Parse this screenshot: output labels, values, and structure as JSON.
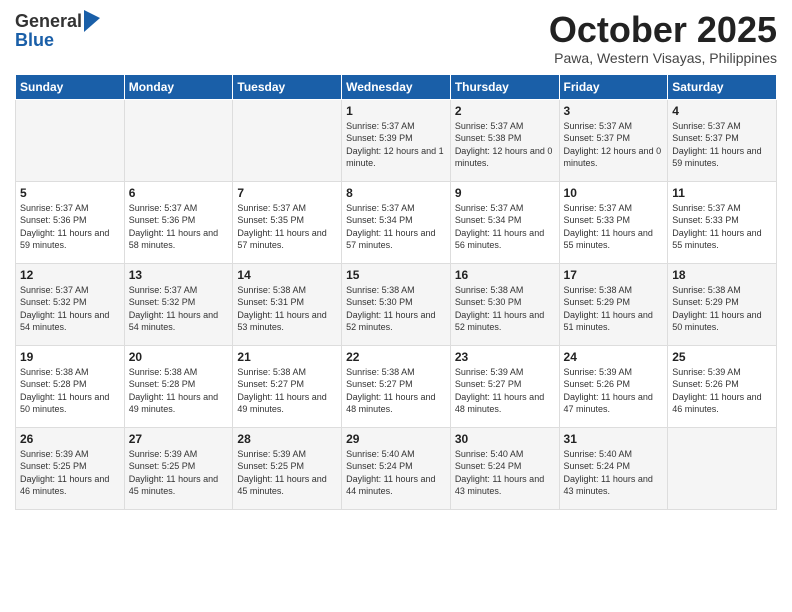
{
  "header": {
    "logo_line1": "General",
    "logo_line2": "Blue",
    "month_title": "October 2025",
    "location": "Pawa, Western Visayas, Philippines"
  },
  "days_of_week": [
    "Sunday",
    "Monday",
    "Tuesday",
    "Wednesday",
    "Thursday",
    "Friday",
    "Saturday"
  ],
  "weeks": [
    [
      {
        "day": "",
        "text": ""
      },
      {
        "day": "",
        "text": ""
      },
      {
        "day": "",
        "text": ""
      },
      {
        "day": "1",
        "text": "Sunrise: 5:37 AM\nSunset: 5:39 PM\nDaylight: 12 hours and 1 minute."
      },
      {
        "day": "2",
        "text": "Sunrise: 5:37 AM\nSunset: 5:38 PM\nDaylight: 12 hours and 0 minutes."
      },
      {
        "day": "3",
        "text": "Sunrise: 5:37 AM\nSunset: 5:37 PM\nDaylight: 12 hours and 0 minutes."
      },
      {
        "day": "4",
        "text": "Sunrise: 5:37 AM\nSunset: 5:37 PM\nDaylight: 11 hours and 59 minutes."
      }
    ],
    [
      {
        "day": "5",
        "text": "Sunrise: 5:37 AM\nSunset: 5:36 PM\nDaylight: 11 hours and 59 minutes."
      },
      {
        "day": "6",
        "text": "Sunrise: 5:37 AM\nSunset: 5:36 PM\nDaylight: 11 hours and 58 minutes."
      },
      {
        "day": "7",
        "text": "Sunrise: 5:37 AM\nSunset: 5:35 PM\nDaylight: 11 hours and 57 minutes."
      },
      {
        "day": "8",
        "text": "Sunrise: 5:37 AM\nSunset: 5:34 PM\nDaylight: 11 hours and 57 minutes."
      },
      {
        "day": "9",
        "text": "Sunrise: 5:37 AM\nSunset: 5:34 PM\nDaylight: 11 hours and 56 minutes."
      },
      {
        "day": "10",
        "text": "Sunrise: 5:37 AM\nSunset: 5:33 PM\nDaylight: 11 hours and 55 minutes."
      },
      {
        "day": "11",
        "text": "Sunrise: 5:37 AM\nSunset: 5:33 PM\nDaylight: 11 hours and 55 minutes."
      }
    ],
    [
      {
        "day": "12",
        "text": "Sunrise: 5:37 AM\nSunset: 5:32 PM\nDaylight: 11 hours and 54 minutes."
      },
      {
        "day": "13",
        "text": "Sunrise: 5:37 AM\nSunset: 5:32 PM\nDaylight: 11 hours and 54 minutes."
      },
      {
        "day": "14",
        "text": "Sunrise: 5:38 AM\nSunset: 5:31 PM\nDaylight: 11 hours and 53 minutes."
      },
      {
        "day": "15",
        "text": "Sunrise: 5:38 AM\nSunset: 5:30 PM\nDaylight: 11 hours and 52 minutes."
      },
      {
        "day": "16",
        "text": "Sunrise: 5:38 AM\nSunset: 5:30 PM\nDaylight: 11 hours and 52 minutes."
      },
      {
        "day": "17",
        "text": "Sunrise: 5:38 AM\nSunset: 5:29 PM\nDaylight: 11 hours and 51 minutes."
      },
      {
        "day": "18",
        "text": "Sunrise: 5:38 AM\nSunset: 5:29 PM\nDaylight: 11 hours and 50 minutes."
      }
    ],
    [
      {
        "day": "19",
        "text": "Sunrise: 5:38 AM\nSunset: 5:28 PM\nDaylight: 11 hours and 50 minutes."
      },
      {
        "day": "20",
        "text": "Sunrise: 5:38 AM\nSunset: 5:28 PM\nDaylight: 11 hours and 49 minutes."
      },
      {
        "day": "21",
        "text": "Sunrise: 5:38 AM\nSunset: 5:27 PM\nDaylight: 11 hours and 49 minutes."
      },
      {
        "day": "22",
        "text": "Sunrise: 5:38 AM\nSunset: 5:27 PM\nDaylight: 11 hours and 48 minutes."
      },
      {
        "day": "23",
        "text": "Sunrise: 5:39 AM\nSunset: 5:27 PM\nDaylight: 11 hours and 48 minutes."
      },
      {
        "day": "24",
        "text": "Sunrise: 5:39 AM\nSunset: 5:26 PM\nDaylight: 11 hours and 47 minutes."
      },
      {
        "day": "25",
        "text": "Sunrise: 5:39 AM\nSunset: 5:26 PM\nDaylight: 11 hours and 46 minutes."
      }
    ],
    [
      {
        "day": "26",
        "text": "Sunrise: 5:39 AM\nSunset: 5:25 PM\nDaylight: 11 hours and 46 minutes."
      },
      {
        "day": "27",
        "text": "Sunrise: 5:39 AM\nSunset: 5:25 PM\nDaylight: 11 hours and 45 minutes."
      },
      {
        "day": "28",
        "text": "Sunrise: 5:39 AM\nSunset: 5:25 PM\nDaylight: 11 hours and 45 minutes."
      },
      {
        "day": "29",
        "text": "Sunrise: 5:40 AM\nSunset: 5:24 PM\nDaylight: 11 hours and 44 minutes."
      },
      {
        "day": "30",
        "text": "Sunrise: 5:40 AM\nSunset: 5:24 PM\nDaylight: 11 hours and 43 minutes."
      },
      {
        "day": "31",
        "text": "Sunrise: 5:40 AM\nSunset: 5:24 PM\nDaylight: 11 hours and 43 minutes."
      },
      {
        "day": "",
        "text": ""
      }
    ]
  ]
}
